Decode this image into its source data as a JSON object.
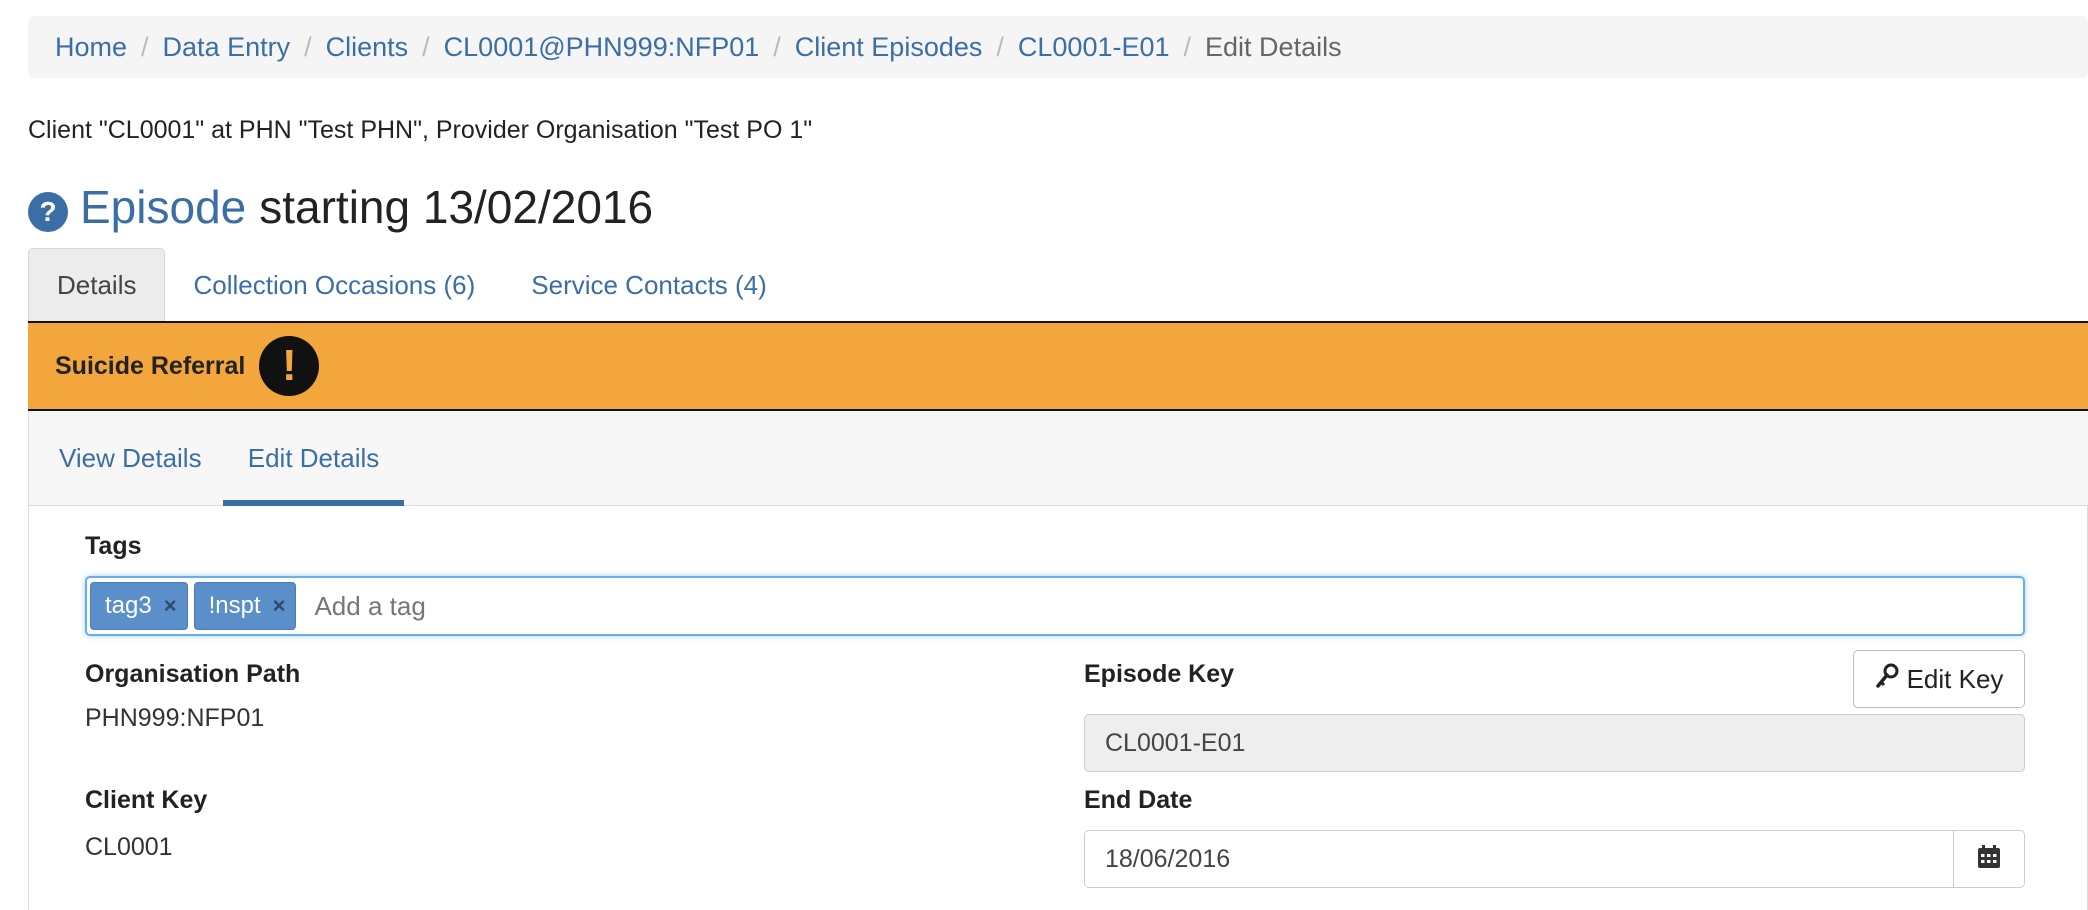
{
  "breadcrumb": [
    {
      "label": "Home"
    },
    {
      "label": "Data Entry"
    },
    {
      "label": "Clients"
    },
    {
      "label": "CL0001@PHN999:NFP01"
    },
    {
      "label": "Client Episodes"
    },
    {
      "label": "CL0001-E01"
    },
    {
      "label": "Edit Details"
    }
  ],
  "context": "Client \"CL0001\" at PHN \"Test PHN\", Provider Organisation \"Test PO 1\"",
  "title": {
    "help_icon": "?",
    "link": "Episode",
    "rest": "starting 13/02/2016"
  },
  "main_tabs": [
    {
      "label": "Details"
    },
    {
      "label": "Collection Occasions (6)"
    },
    {
      "label": "Service Contacts (4)"
    }
  ],
  "alert": {
    "label": "Suicide Referral",
    "icon": "exclamation-icon",
    "icon_glyph": "!",
    "color": "#f2a63b"
  },
  "sub_tabs": [
    {
      "label": "View Details"
    },
    {
      "label": "Edit Details"
    }
  ],
  "form": {
    "tags_label": "Tags",
    "tags": [
      {
        "label": "tag3",
        "remove": "×"
      },
      {
        "label": "!nspt",
        "remove": "×"
      }
    ],
    "tags_placeholder": "Add a tag",
    "org_path_label": "Organisation Path",
    "org_path_value": "PHN999:NFP01",
    "episode_key_label": "Episode Key",
    "episode_key_value": "CL0001-E01",
    "edit_key_label": "Edit Key",
    "client_key_label": "Client Key",
    "client_key_value": "CL0001",
    "end_date_label": "End Date",
    "end_date_value": "18/06/2016"
  },
  "colors": {
    "accent": "#3a6ea5",
    "tag": "#5b8fc9"
  }
}
